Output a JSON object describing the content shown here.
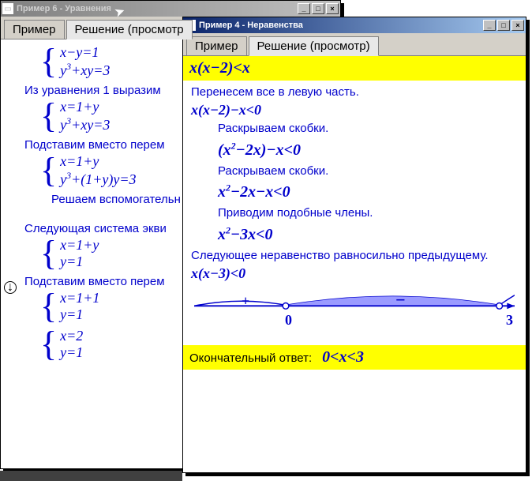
{
  "cursor_glyph": "➤",
  "win1": {
    "title": "Пример 6 - Уравнения",
    "min_glyph": "_",
    "max_glyph": "□",
    "close_glyph": "×",
    "tabs": [
      "Пример",
      "Решение (просмотр"
    ],
    "indent_arrow": "↓",
    "systems": [
      {
        "row1": "x−y=1",
        "row2_a": "y",
        "row2_sup": "3",
        "row2_b": "+xy=3"
      },
      {
        "row1": "x=1+y",
        "row2_a": "y",
        "row2_sup": "3",
        "row2_b": "+xy=3"
      },
      {
        "row1": "x=1+y",
        "row2_a": "y",
        "row2_sup": "3",
        "row2_b": "+(1+y)y=3"
      },
      {
        "row1": "x=1+y",
        "row2_a": "y=1",
        "row2_sup": "",
        "row2_b": ""
      },
      {
        "row1": "x=1+1",
        "row2_a": "y=1",
        "row2_sup": "",
        "row2_b": ""
      },
      {
        "row1": "x=2",
        "row2_a": "y=1",
        "row2_sup": "",
        "row2_b": ""
      }
    ],
    "steps": [
      "Из уравнения 1 выразим",
      "Подставим вместо перем",
      "Решаем вспомогательн",
      "Следующая система экви",
      "Подставим вместо перем"
    ]
  },
  "win2": {
    "title": "Пример 4 - Неравенства",
    "min_glyph": "_",
    "max_glyph": "□",
    "close_glyph": "×",
    "tabs": [
      "Пример",
      "Решение (просмотр)"
    ],
    "problem": "x(x−2)<x",
    "steps_text": [
      "Перенесем все в левую часть.",
      "Раскрываем скобки.",
      "Раскрываем скобки.",
      "Приводим подобные члены.",
      "Следующее неравенство равносильно предыдущему."
    ],
    "eqs": {
      "e1": "x(x−2)−x<0",
      "e2_a": "(x",
      "e2_sup": "2",
      "e2_b": "−2x)−x<0",
      "e3_a": "x",
      "e3_sup": "2",
      "e3_b": "−2x−x<0",
      "e4_a": "x",
      "e4_sup": "2",
      "e4_b": "−3x<0",
      "e5": "x(x−3)<0"
    },
    "numline": {
      "left_sign": "+",
      "right_sign": "−",
      "tick0": "0",
      "tick1": "3"
    },
    "answer_label": "Окончательный ответ:",
    "answer": "0<x<3"
  }
}
